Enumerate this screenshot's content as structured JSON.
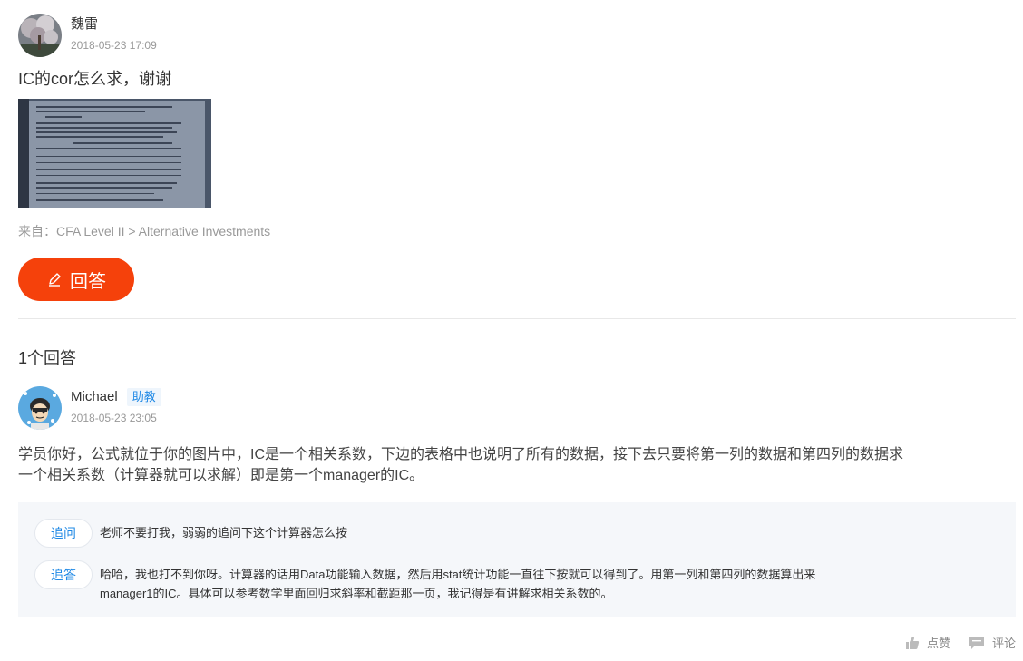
{
  "question": {
    "author": {
      "name": "魏雷",
      "timestamp": "2018-05-23 17:09"
    },
    "title": "IC的cor怎么求，谢谢",
    "source": "来自：CFA Level II > Alternative Investments",
    "answer_button_label": "回答"
  },
  "answers_header": "1个回答",
  "answer": {
    "author": {
      "name": "Michael",
      "role": "助教",
      "timestamp": "2018-05-23 23:05"
    },
    "body": "学员你好，公式就位于你的图片中，IC是一个相关系数，下边的表格中也说明了所有的数据，接下去只要将第一列的数据和第四列的数据求一个相关系数（计算器就可以求解）即是第一个manager的IC。",
    "followups": [
      {
        "tag": "追问",
        "text": "老师不要打我，弱弱的追问下这个计算器怎么按"
      },
      {
        "tag": "追答",
        "text": "哈哈，我也打不到你呀。计算器的话用Data功能输入数据，然后用stat统计功能一直往下按就可以得到了。用第一列和第四列的数据算出来manager1的IC。具体可以参考数学里面回归求斜率和截距那一页，我记得是有讲解求相关系数的。"
      }
    ]
  },
  "actions": {
    "like_label": "点赞",
    "comment_label": "评论"
  },
  "colors": {
    "accent": "#f5410b",
    "link": "#1e88e5",
    "panel_bg": "#f5f7fa"
  }
}
